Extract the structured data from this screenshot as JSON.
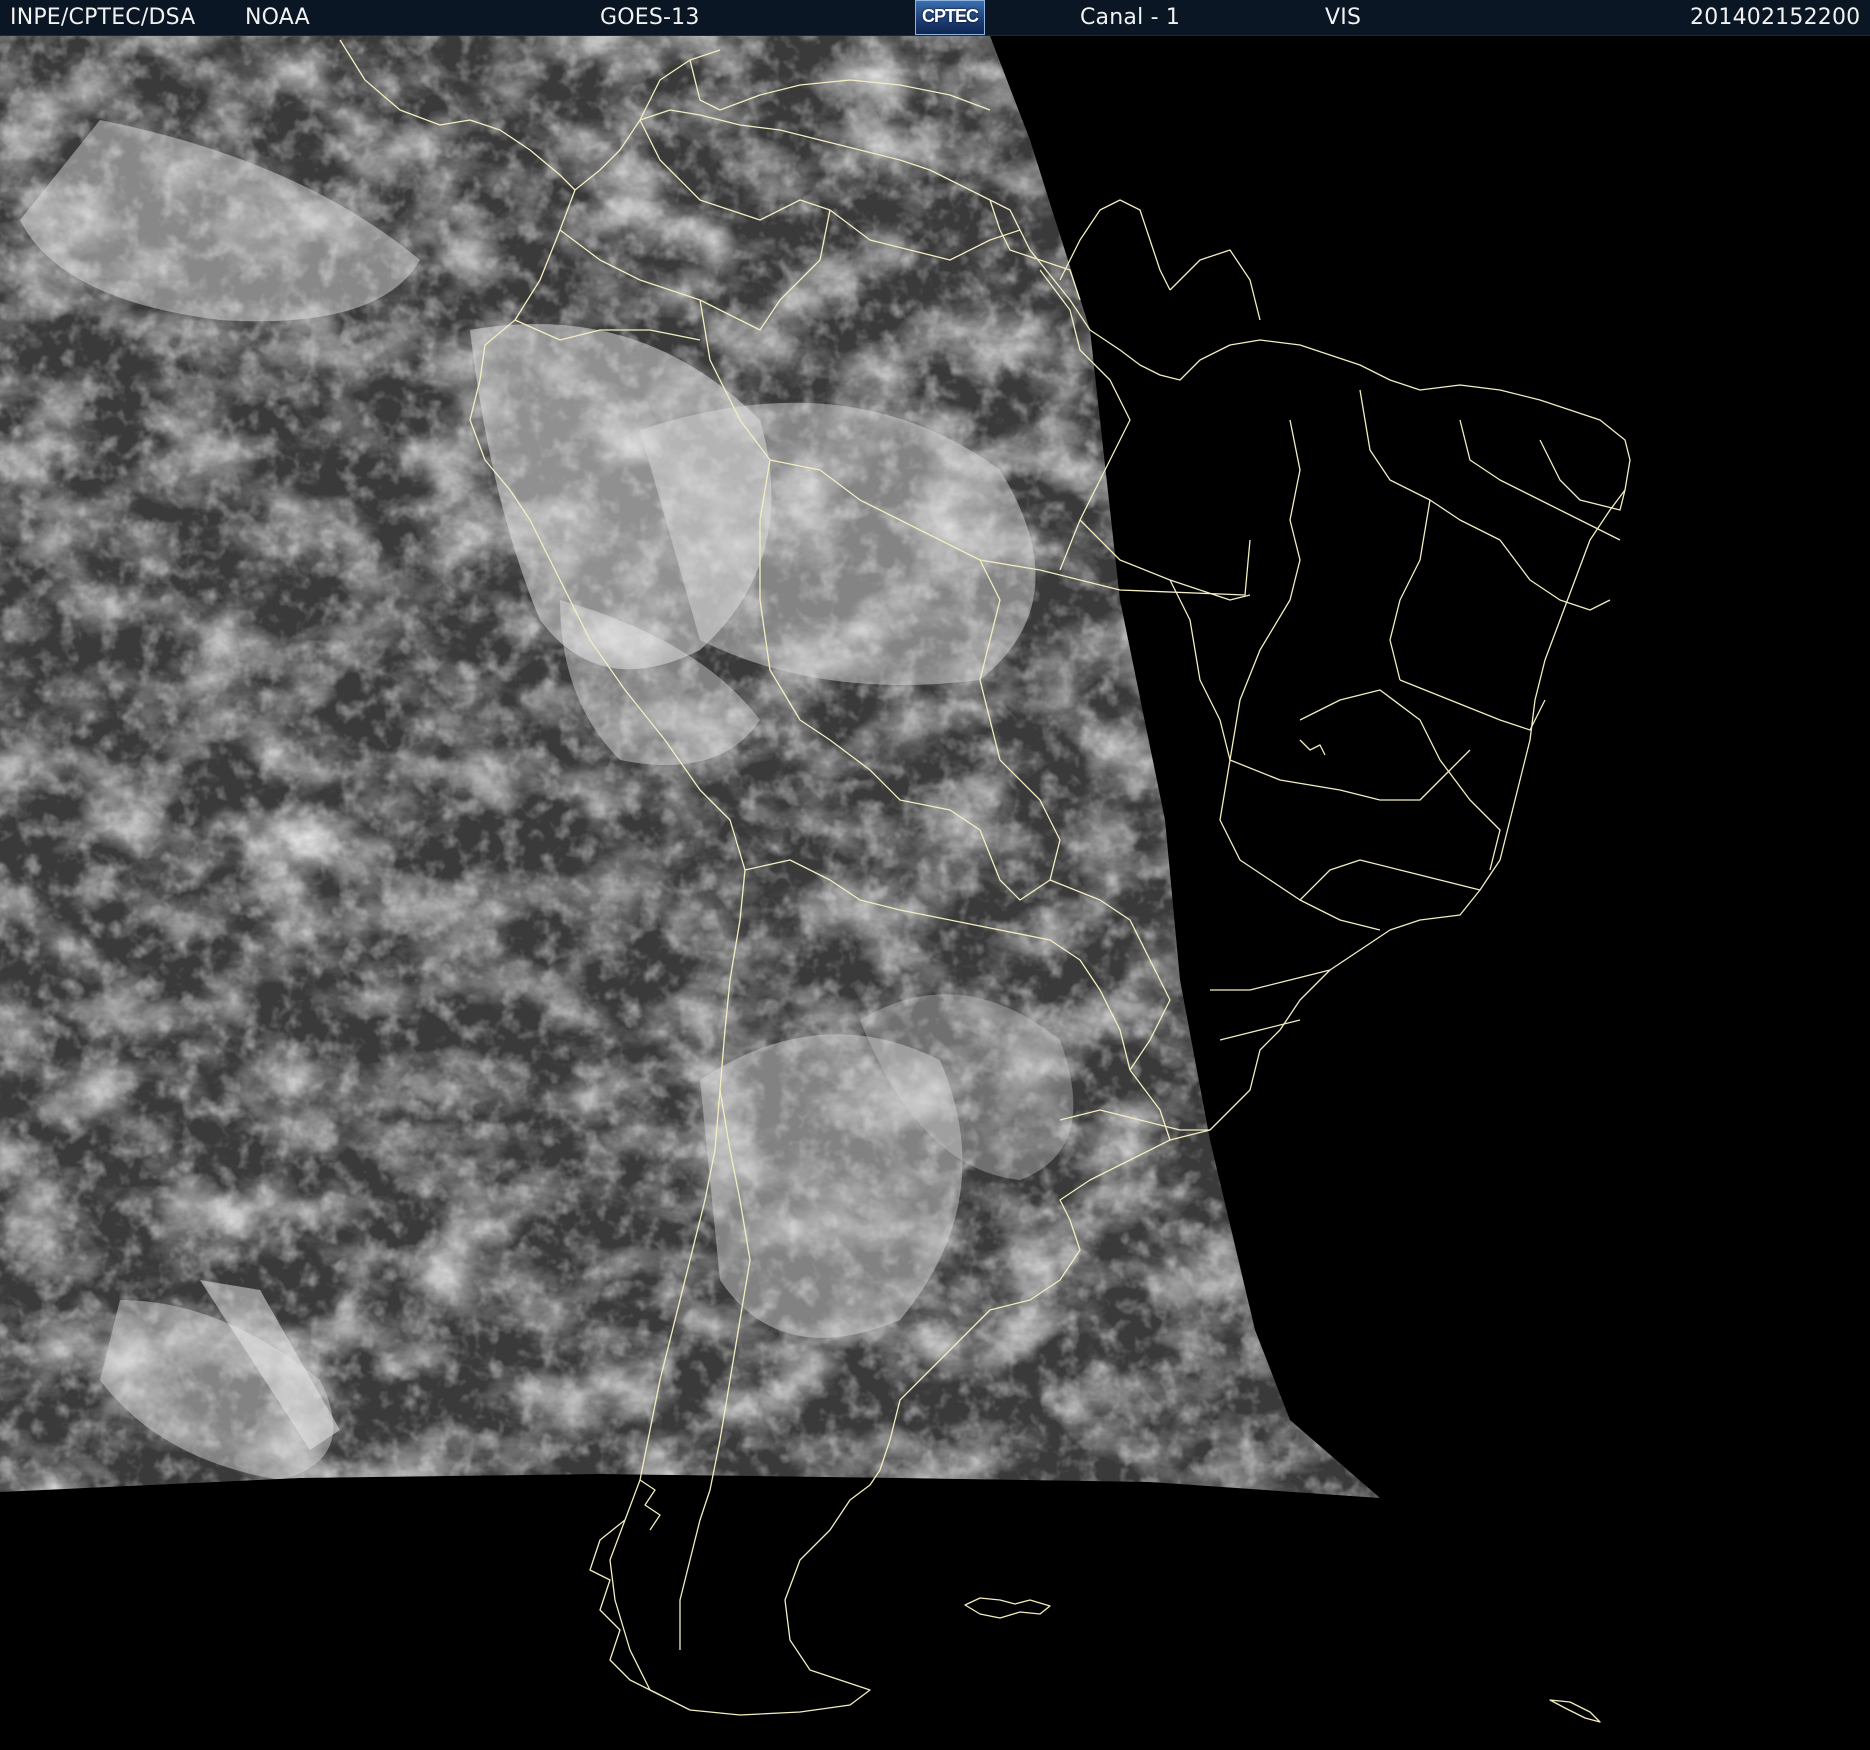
{
  "header": {
    "institution": "INPE/CPTEC/DSA",
    "agency": "NOAA",
    "satellite": "GOES-13",
    "logo_text": "CPTEC",
    "channel": "Canal - 1",
    "band": "VIS",
    "timestamp": "201402152200"
  },
  "colors": {
    "header_bg": "#0a1624",
    "header_text": "#f2f2f2",
    "map_outline": "#f2eec0",
    "space": "#000000",
    "ocean_vis": "#3a3a3a",
    "cloud": "#d8d8d8"
  },
  "imagery": {
    "kind": "visible satellite image",
    "region": "South America",
    "outline_layers": [
      "coastlines",
      "country borders",
      "brazilian state borders"
    ]
  }
}
